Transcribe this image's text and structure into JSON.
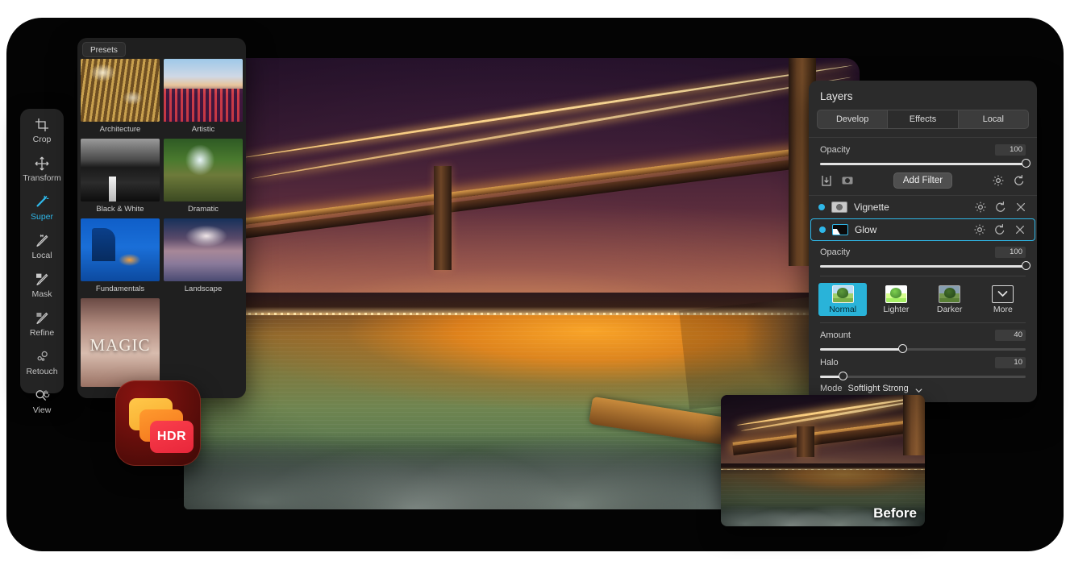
{
  "app": {
    "badge": {
      "name": "hdr-app-icon",
      "label": "HDR"
    }
  },
  "toolrail": {
    "items": [
      {
        "icon": "crop-icon",
        "label": "Crop",
        "active": false
      },
      {
        "icon": "transform-icon",
        "label": "Transform",
        "active": false
      },
      {
        "icon": "magic-wand-icon",
        "label": "Super",
        "active": true
      },
      {
        "icon": "brush-icon",
        "label": "Local",
        "active": false
      },
      {
        "icon": "mask-icon",
        "label": "Mask",
        "active": false
      },
      {
        "icon": "refine-icon",
        "label": "Refine",
        "active": false
      },
      {
        "icon": "retouch-icon",
        "label": "Retouch",
        "active": false
      },
      {
        "icon": "magnifier-hand-icon",
        "label": "View",
        "active": false
      }
    ],
    "active_color": "#2fb7e8"
  },
  "presets": {
    "tab_label": "Presets",
    "items": [
      {
        "label": "Architecture"
      },
      {
        "label": "Artistic"
      },
      {
        "label": "Black & White"
      },
      {
        "label": "Dramatic"
      },
      {
        "label": "Fundamentals"
      },
      {
        "label": "Landscape"
      },
      {
        "label": "MAGIC"
      }
    ]
  },
  "layers": {
    "title": "Layers",
    "tabs": [
      {
        "label": "Develop",
        "active": false
      },
      {
        "label": "Effects",
        "active": true
      },
      {
        "label": "Local",
        "active": false
      }
    ],
    "opacity": {
      "label": "Opacity",
      "value": "100",
      "percent": 100
    },
    "toolbar": {
      "import_icon": "import-icon",
      "mask_icon": "mask-thumbnail-icon",
      "add_filter_label": "Add Filter",
      "settings_icon": "gear-icon",
      "reset_icon": "reset-icon"
    },
    "items": [
      {
        "name": "Vignette",
        "enabled": true,
        "selected": false,
        "thumb": "vignette-thumbnail-icon",
        "actions": [
          "gear-icon",
          "reset-icon",
          "close-icon"
        ]
      },
      {
        "name": "Glow",
        "enabled": true,
        "selected": true,
        "thumb": "glow-thumbnail-icon",
        "actions": [
          "gear-icon",
          "reset-icon",
          "close-icon"
        ]
      }
    ],
    "filter_panel": {
      "opacity": {
        "label": "Opacity",
        "value": "100",
        "percent": 100
      },
      "blend_modes": [
        {
          "label": "Normal",
          "active": true,
          "icon": "tree-thumbnail-icon"
        },
        {
          "label": "Lighter",
          "active": false,
          "icon": "tree-thumbnail-light-icon"
        },
        {
          "label": "Darker",
          "active": false,
          "icon": "tree-thumbnail-dark-icon"
        },
        {
          "label": "More",
          "active": false,
          "icon": "chevron-down-icon"
        }
      ],
      "sliders": [
        {
          "label": "Amount",
          "value": "40",
          "percent": 40
        },
        {
          "label": "Halo",
          "value": "10",
          "percent": 10
        }
      ],
      "mode": {
        "label": "Mode",
        "value": "Softlight Strong",
        "chevron": "chevron-down-icon"
      }
    },
    "accent_color": "#2fb7e8"
  },
  "before_preview": {
    "label": "Before"
  }
}
